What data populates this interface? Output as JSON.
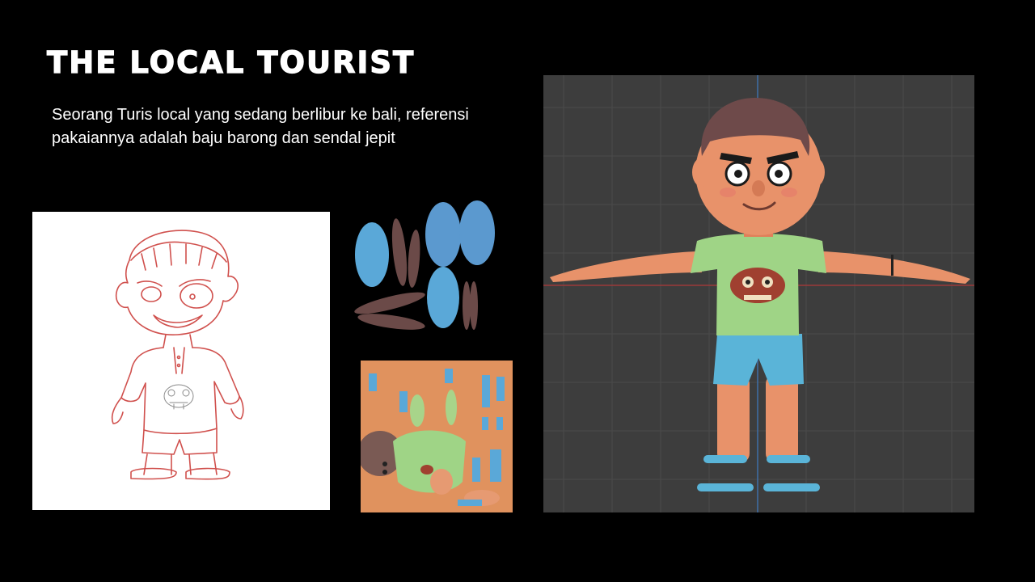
{
  "slide": {
    "title": "THE LOCAL TOURIST",
    "description": "Seorang Turis local yang sedang berlibur ke bali, referensi pakaiannya adalah baju barong dan sendal jepit"
  },
  "colors": {
    "background": "#000000",
    "text": "#ffffff",
    "sketch_line": "#c8322e",
    "viewport_bg": "#3d3d3d",
    "grid_line": "#4a4a4a",
    "axis_red": "#9c3a3a",
    "axis_blue": "#3e6fa8",
    "skin": "#e8926a",
    "shirt": "#9fd486",
    "shorts": "#5ab4d8",
    "hair": "#6e4a4a",
    "uv_blue": "#5aa8d8",
    "uv_brown": "#6b4a48"
  },
  "icons": {
    "sketch": "character-sketch-illustration",
    "uv": "uv-island-layout",
    "texture": "texture-atlas-map",
    "viewport": "3d-model-t-pose-render"
  }
}
